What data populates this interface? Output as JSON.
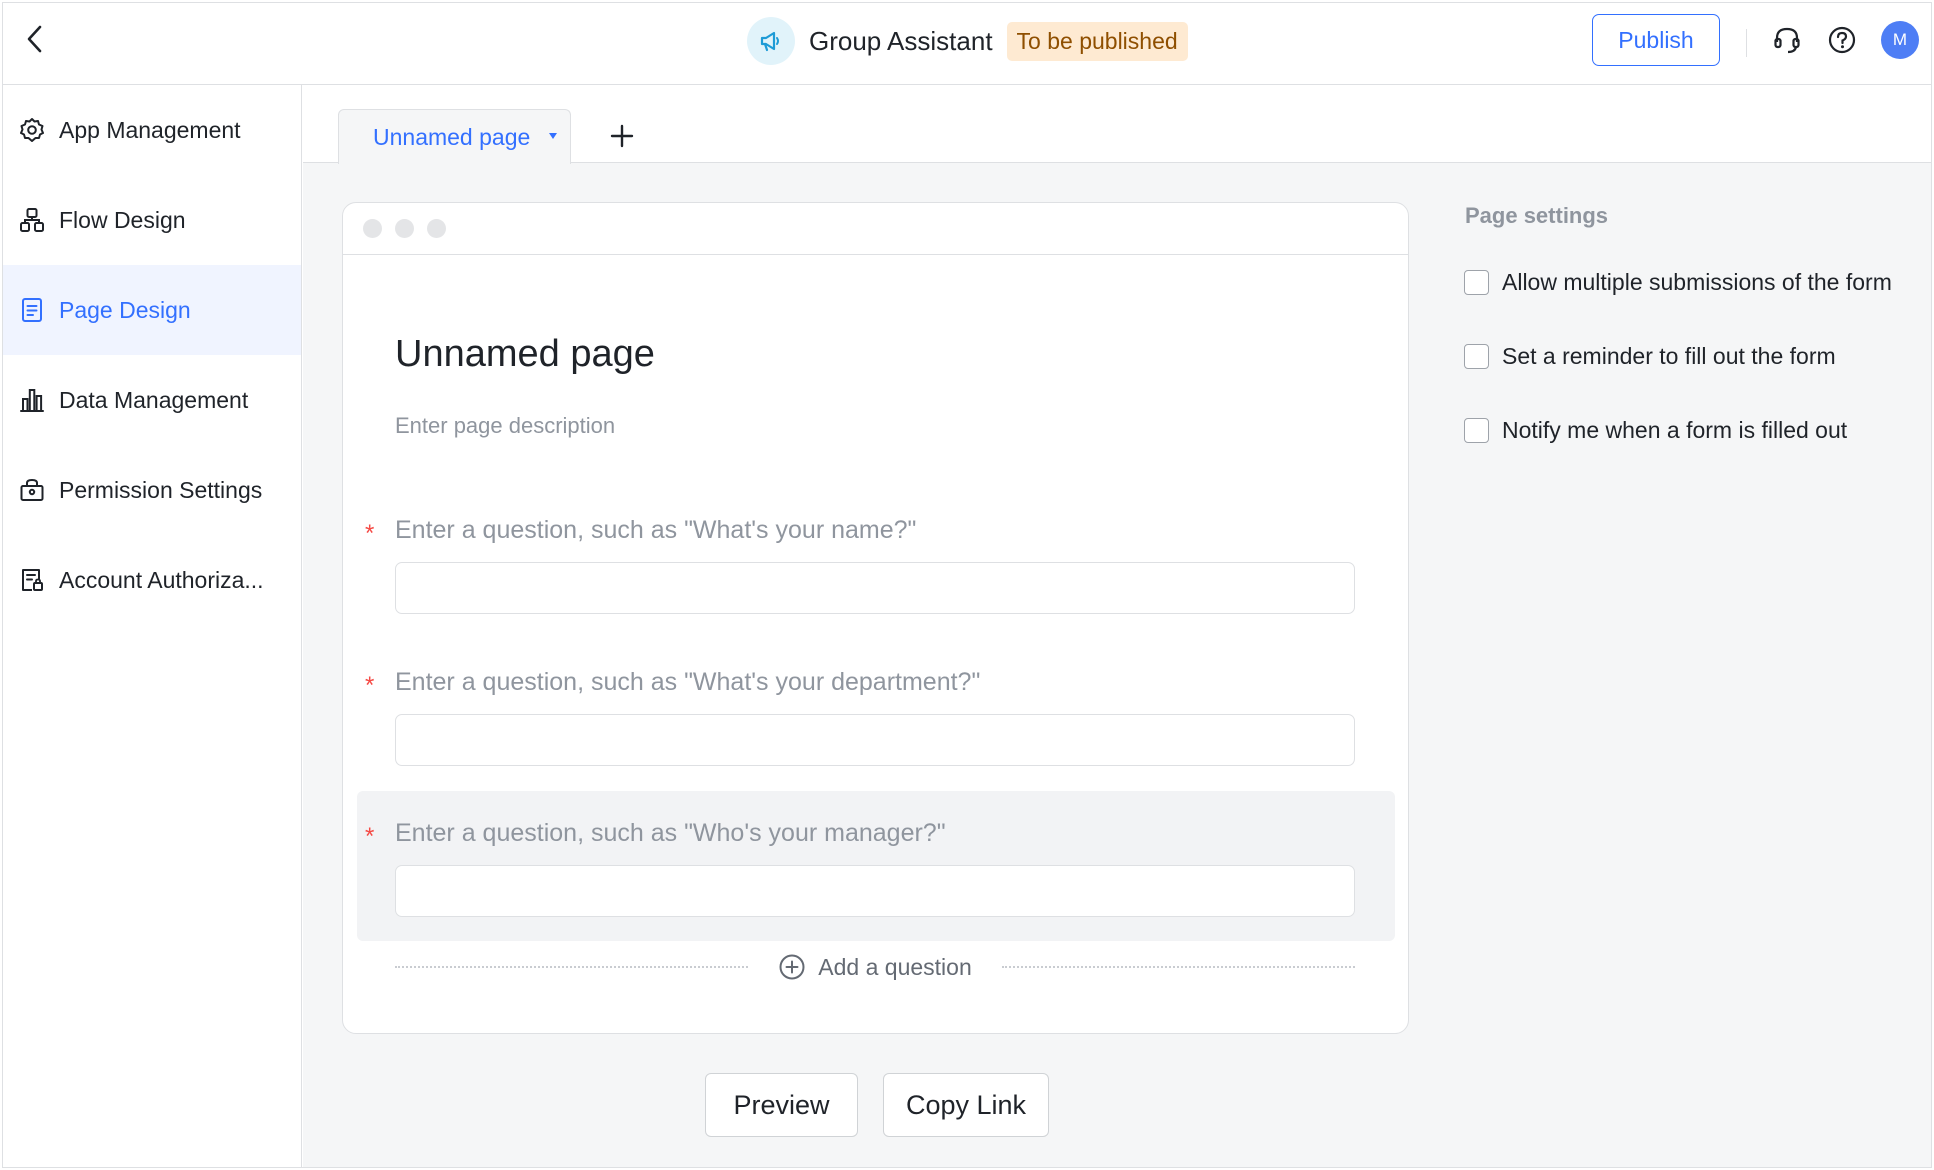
{
  "header": {
    "app_title": "Group Assistant",
    "status": "To be published",
    "publish_label": "Publish",
    "avatar_initial": "M"
  },
  "sidebar": {
    "items": [
      {
        "label": "App Management",
        "icon": "gear-icon"
      },
      {
        "label": "Flow Design",
        "icon": "flow-icon"
      },
      {
        "label": "Page Design",
        "icon": "document-icon",
        "active": true
      },
      {
        "label": "Data Management",
        "icon": "bar-chart-icon"
      },
      {
        "label": "Permission Settings",
        "icon": "lock-bag-icon"
      },
      {
        "label": "Account Authoriza...",
        "icon": "account-auth-icon"
      }
    ]
  },
  "tabs": {
    "active_label": "Unnamed page"
  },
  "form": {
    "title": "Unnamed page",
    "description_placeholder": "Enter page description",
    "questions": [
      {
        "label": "Enter a question, such as \"What's your name?\"",
        "required": true
      },
      {
        "label": "Enter a question, such as \"What's your department?\"",
        "required": true
      },
      {
        "label": "Enter a question, such as \"Who's your manager?\"",
        "required": true
      }
    ],
    "required_mark": "*",
    "add_question_label": "Add a question"
  },
  "actions": {
    "preview_label": "Preview",
    "copy_link_label": "Copy Link"
  },
  "settings": {
    "title": "Page settings",
    "options": [
      {
        "label": "Allow multiple submissions of the form",
        "checked": false
      },
      {
        "label": "Set a reminder to fill out the form",
        "checked": false
      },
      {
        "label": "Notify me when a form is filled out",
        "checked": false
      }
    ]
  },
  "colors": {
    "accent": "#3370ff",
    "badge_bg": "#feead2",
    "required": "#f54a45"
  }
}
